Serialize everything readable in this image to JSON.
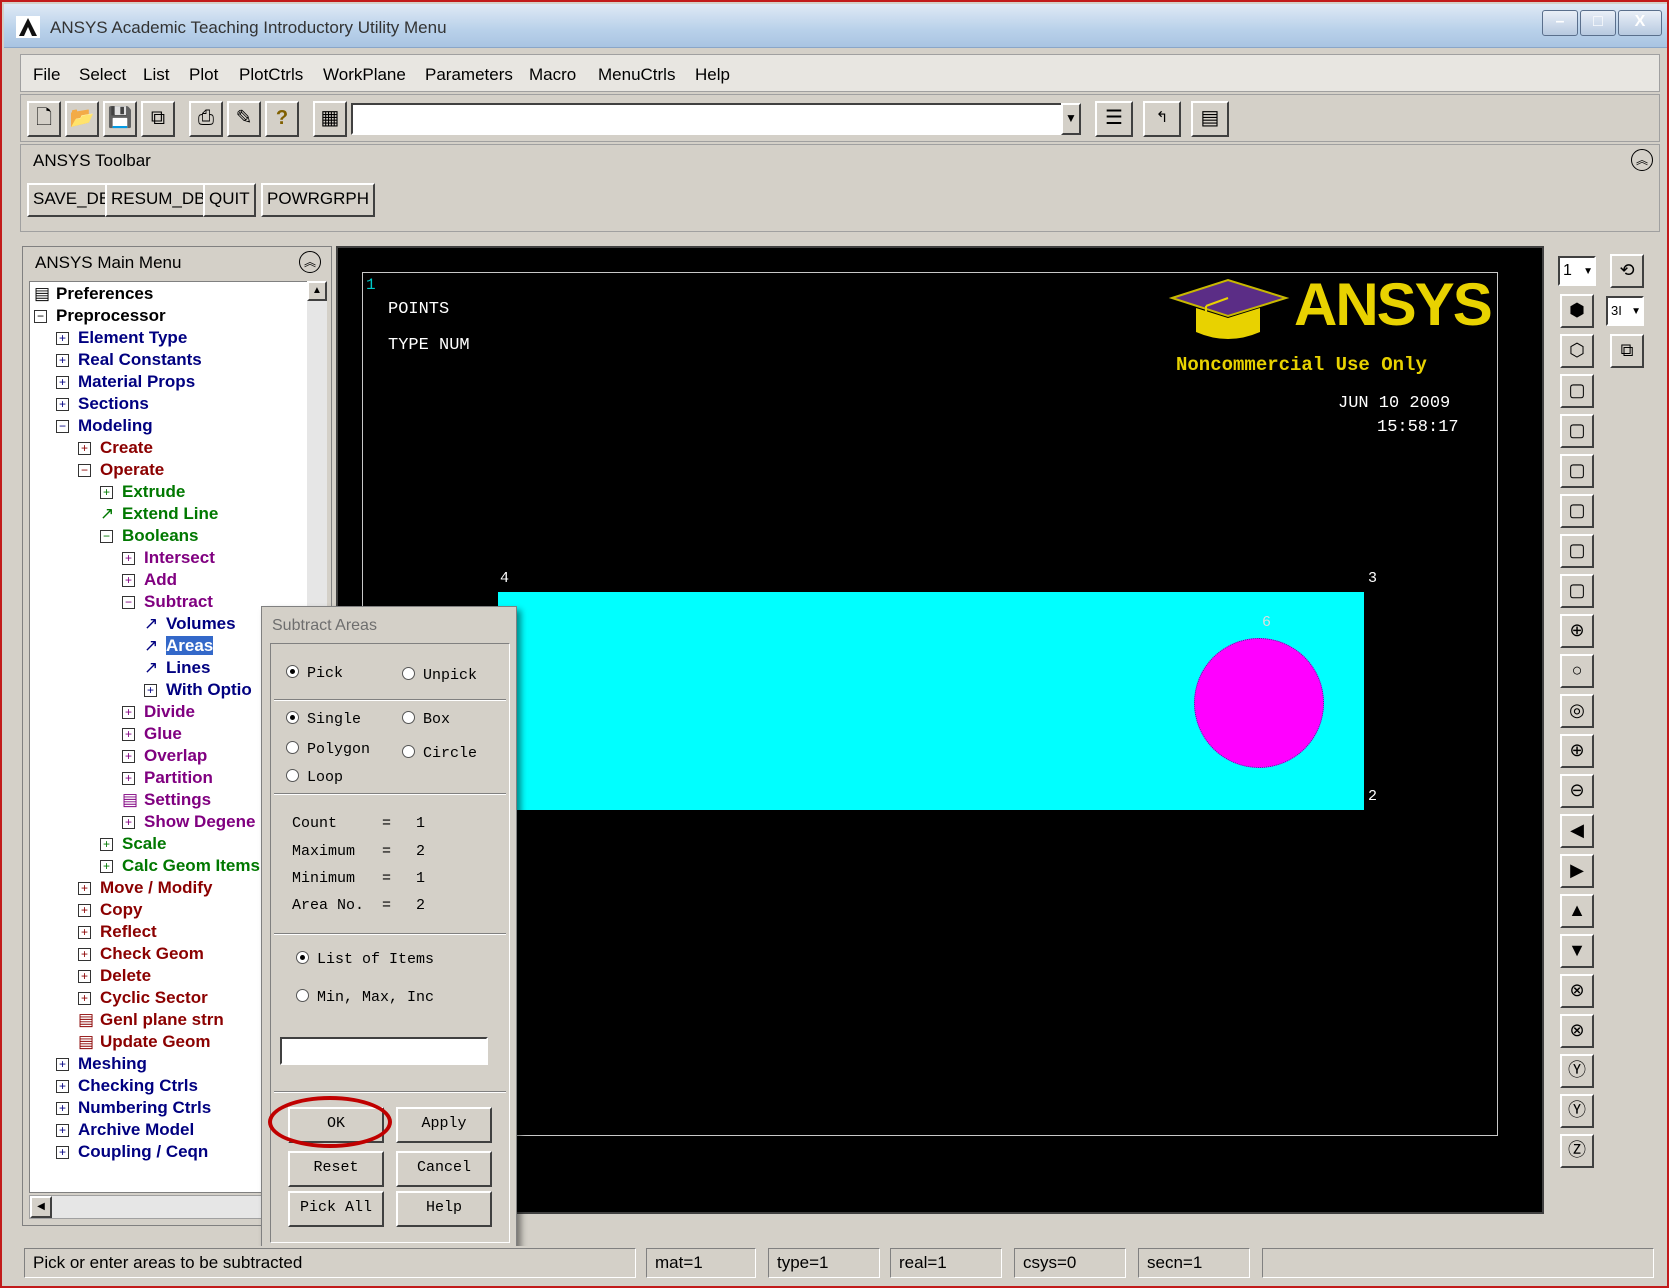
{
  "window": {
    "title": "ANSYS Academic Teaching Introductory Utility Menu",
    "controls": [
      "–",
      "□",
      "X"
    ]
  },
  "menubar": [
    "File",
    "Select",
    "List",
    "Plot",
    "PlotCtrls",
    "WorkPlane",
    "Parameters",
    "Macro",
    "MenuCtrls",
    "Help"
  ],
  "toolbar": {
    "icons": [
      "new-file-icon",
      "open-icon",
      "save-icon",
      "export-icon",
      "print-icon",
      "report-icon",
      "help-icon",
      "command-window-icon"
    ],
    "command_value": "",
    "right_icons": [
      "raise-hidden-icon",
      "reset-picking-icon",
      "contact-manager-icon"
    ]
  },
  "ansys_toolbar": {
    "title": "ANSYS Toolbar",
    "buttons": [
      "SAVE_DB",
      "RESUM_DB",
      "QUIT",
      "POWRGRPH"
    ]
  },
  "main_menu": {
    "title": "ANSYS Main Menu",
    "items": [
      {
        "label": "Preferences"
      },
      {
        "label": "Preprocessor"
      },
      {
        "label": "Element Type"
      },
      {
        "label": "Real Constants"
      },
      {
        "label": "Material Props"
      },
      {
        "label": "Sections"
      },
      {
        "label": "Modeling"
      },
      {
        "label": "Create"
      },
      {
        "label": "Operate"
      },
      {
        "label": "Extrude"
      },
      {
        "label": "Extend Line"
      },
      {
        "label": "Booleans"
      },
      {
        "label": "Intersect"
      },
      {
        "label": "Add"
      },
      {
        "label": "Subtract"
      },
      {
        "label": "Volumes"
      },
      {
        "label": "Areas"
      },
      {
        "label": "Lines"
      },
      {
        "label": "With Optio"
      },
      {
        "label": "Divide"
      },
      {
        "label": "Glue"
      },
      {
        "label": "Overlap"
      },
      {
        "label": "Partition"
      },
      {
        "label": "Settings"
      },
      {
        "label": "Show Degene"
      },
      {
        "label": "Scale"
      },
      {
        "label": "Calc Geom Items"
      },
      {
        "label": "Move / Modify"
      },
      {
        "label": "Copy"
      },
      {
        "label": "Reflect"
      },
      {
        "label": "Check Geom"
      },
      {
        "label": "Delete"
      },
      {
        "label": "Cyclic Sector"
      },
      {
        "label": "Genl plane strn"
      },
      {
        "label": "Update Geom"
      },
      {
        "label": "Meshing"
      },
      {
        "label": "Checking Ctrls"
      },
      {
        "label": "Numbering Ctrls"
      },
      {
        "label": "Archive Model"
      },
      {
        "label": "Coupling / Ceqn"
      }
    ]
  },
  "graphics": {
    "window_number": "1",
    "label_line1": "POINTS",
    "label_line2": "TYPE NUM",
    "logo_text": "ANSYS",
    "logo_sub": "Noncommercial Use Only",
    "date": "JUN 10 2009",
    "time": "15:58:17",
    "kp_4": "4",
    "kp_3": "3",
    "kp_2": "2",
    "kp_6": "6",
    "colors": {
      "rectangle": "#00ffff",
      "circle": "#ff00ff",
      "logo": "#e8d200",
      "hat": "#5b2d86"
    }
  },
  "right_tools": {
    "window_select": "1",
    "view_select": "3I",
    "icons": [
      "iso-view-icon",
      "oblique-view-icon",
      "front-view-icon",
      "right-view-icon",
      "top-view-icon",
      "back-view-icon",
      "left-view-icon",
      "bottom-view-icon",
      "zoom-icon",
      "box-zoom-icon",
      "win-zoom-icon",
      "back-up-icon",
      "zoom-in-icon",
      "zoom-out-icon",
      "pan-left-icon",
      "pan-right-icon",
      "pan-up-icon",
      "pan-down-icon",
      "rotate-x-icon",
      "rotate-x-neg-icon",
      "rotate-y-icon",
      "rotate-y-neg-icon",
      "rotate-z-icon"
    ]
  },
  "dialog": {
    "title": "Subtract Areas",
    "pick": "Pick",
    "unpick": "Unpick",
    "single": "Single",
    "box": "Box",
    "polygon": "Polygon",
    "circle": "Circle",
    "loop": "Loop",
    "count_label": "Count",
    "count": "1",
    "maximum_label": "Maximum",
    "maximum": "2",
    "minimum_label": "Minimum",
    "minimum": "1",
    "area_label": "Area No.",
    "area_no": "2",
    "eq": "=",
    "list_of_items": "List of Items",
    "min_max_inc": "Min, Max, Inc",
    "input_value": "",
    "buttons": {
      "ok": "OK",
      "apply": "Apply",
      "reset": "Reset",
      "cancel": "Cancel",
      "pick_all": "Pick All",
      "help": "Help"
    }
  },
  "status": {
    "prompt": "Pick or enter areas to be subtracted",
    "mat": "mat=1",
    "type": "type=1",
    "real": "real=1",
    "csys": "csys=0",
    "secn": "secn=1"
  }
}
